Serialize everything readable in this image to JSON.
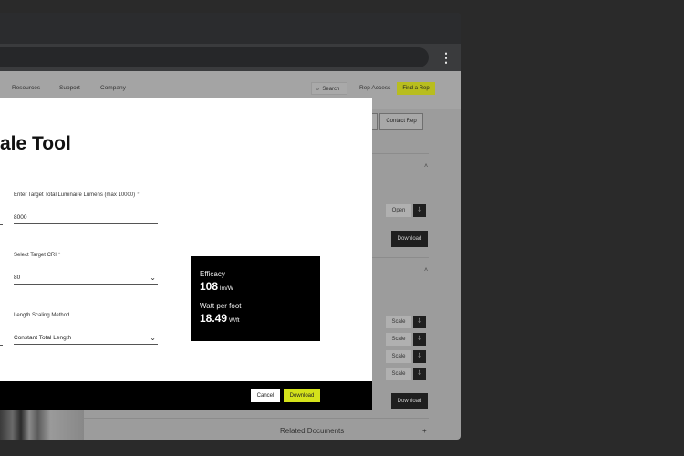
{
  "browser": {
    "menu_icon": "⋮"
  },
  "nav": {
    "links": [
      "Resources",
      "Support",
      "Company"
    ],
    "search_icon": "⌕",
    "search_label": "Search",
    "rep_access": "Rep Access",
    "find_rep": "Find a Rep"
  },
  "page": {
    "contact_rep": "Contact Rep",
    "open_label": "Open",
    "download_label": "Download",
    "scale_label": "Scale",
    "related_documents": "Related Documents",
    "plus": "+",
    "chevron": "˄",
    "icon_glyph": "⇩"
  },
  "modal": {
    "title": "ale Tool",
    "fields": [
      {
        "label": "Enter Target Total Luminaire Lumens (max 10000)",
        "required": "*",
        "value": "8000"
      },
      {
        "label": "Select Target CRI",
        "required": "*",
        "value": "80"
      },
      {
        "label": "Length Scaling Method",
        "value": "Constant Total Length"
      }
    ],
    "chevron_down": "⌄",
    "results": {
      "efficacy_label": "Efficacy",
      "efficacy_value": "108",
      "efficacy_unit": "lm/W",
      "wpf_label": "Watt per foot",
      "wpf_value": "18.49",
      "wpf_unit": "W/ft"
    },
    "cancel": "Cancel",
    "download": "Download"
  },
  "colors": {
    "accent": "#d4e21b",
    "overlay": "#9c9c9c",
    "results_bg": "#000000"
  }
}
